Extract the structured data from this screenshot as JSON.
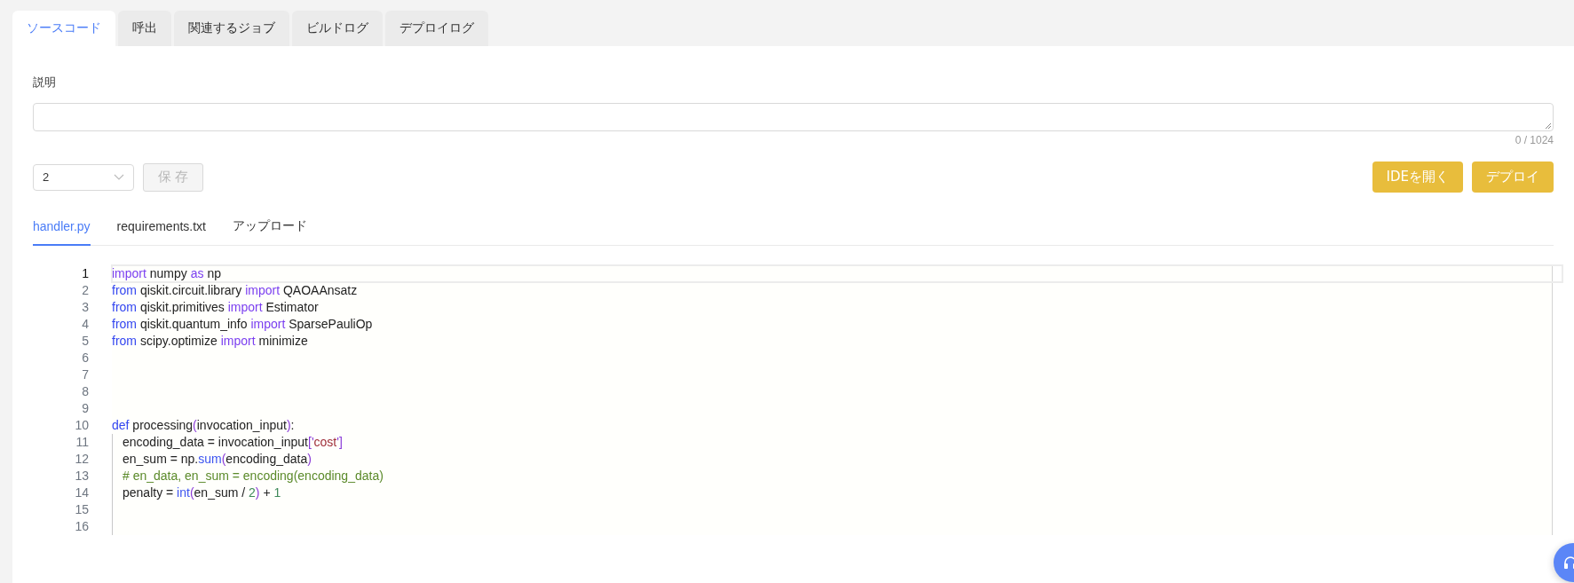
{
  "tabs": [
    {
      "label": "ソースコード",
      "selected": true
    },
    {
      "label": "呼出",
      "selected": false
    },
    {
      "label": "関連するジョブ",
      "selected": false
    },
    {
      "label": "ビルドログ",
      "selected": false
    },
    {
      "label": "デプロイログ",
      "selected": false
    }
  ],
  "description": {
    "label": "説明",
    "counter": "0 / 1024"
  },
  "version_select": {
    "value": "2"
  },
  "save_button": {
    "label": "保 存",
    "disabled": true
  },
  "actions": [
    {
      "label": "IDEを開く"
    },
    {
      "label": "デプロイ"
    }
  ],
  "file_tabs": [
    {
      "label": "handler.py",
      "selected": true
    },
    {
      "label": "requirements.txt",
      "selected": false
    },
    {
      "label": "アップロード",
      "selected": false
    }
  ],
  "editor": {
    "lines": [
      {
        "number": "1",
        "current": true,
        "indented": false,
        "tokens": [
          {
            "kind": "keyword",
            "text": "import"
          },
          {
            "kind": "plain",
            "text": " numpy "
          },
          {
            "kind": "keyword",
            "text": "as"
          },
          {
            "kind": "plain",
            "text": " np"
          }
        ]
      },
      {
        "number": "2",
        "current": false,
        "indented": false,
        "tokens": [
          {
            "kind": "control",
            "text": "from"
          },
          {
            "kind": "plain",
            "text": " qiskit.circuit.library "
          },
          {
            "kind": "keyword",
            "text": "import"
          },
          {
            "kind": "plain",
            "text": " QAOAAnsatz"
          }
        ]
      },
      {
        "number": "3",
        "current": false,
        "indented": false,
        "tokens": [
          {
            "kind": "control",
            "text": "from"
          },
          {
            "kind": "plain",
            "text": " qiskit.primitives "
          },
          {
            "kind": "keyword",
            "text": "import"
          },
          {
            "kind": "plain",
            "text": " Estimator"
          }
        ]
      },
      {
        "number": "4",
        "current": false,
        "indented": false,
        "tokens": [
          {
            "kind": "control",
            "text": "from"
          },
          {
            "kind": "plain",
            "text": " qiskit.quantum_info "
          },
          {
            "kind": "keyword",
            "text": "import"
          },
          {
            "kind": "plain",
            "text": " SparsePauliOp"
          }
        ]
      },
      {
        "number": "5",
        "current": false,
        "indented": false,
        "tokens": [
          {
            "kind": "control",
            "text": "from"
          },
          {
            "kind": "plain",
            "text": " scipy.optimize "
          },
          {
            "kind": "keyword",
            "text": "import"
          },
          {
            "kind": "plain",
            "text": " minimize"
          }
        ]
      },
      {
        "number": "6",
        "current": false,
        "indented": false
      },
      {
        "number": "7",
        "current": false,
        "indented": false
      },
      {
        "number": "8",
        "current": false,
        "indented": false
      },
      {
        "number": "9",
        "current": false,
        "indented": false
      },
      {
        "number": "10",
        "current": false,
        "indented": false,
        "tokens": [
          {
            "kind": "control",
            "text": "def"
          },
          {
            "kind": "plain",
            "text": " processing"
          },
          {
            "kind": "bracket",
            "text": "("
          },
          {
            "kind": "plain",
            "text": "invocation_input"
          },
          {
            "kind": "bracket",
            "text": ")"
          },
          {
            "kind": "plain",
            "text": ":"
          }
        ]
      },
      {
        "number": "11",
        "current": false,
        "indented": true,
        "tokens": [
          {
            "kind": "plain",
            "text": "encoding_data = invocation_input"
          },
          {
            "kind": "bracket",
            "text": "['"
          },
          {
            "kind": "string",
            "text": "cost"
          },
          {
            "kind": "bracket",
            "text": "']"
          }
        ]
      },
      {
        "number": "12",
        "current": false,
        "indented": true,
        "tokens": [
          {
            "kind": "plain",
            "text": "en_sum = np."
          },
          {
            "kind": "builtin",
            "text": "sum"
          },
          {
            "kind": "bracket",
            "text": "("
          },
          {
            "kind": "plain",
            "text": "encoding_data"
          },
          {
            "kind": "bracket",
            "text": ")"
          }
        ]
      },
      {
        "number": "13",
        "current": false,
        "indented": true,
        "tokens": [
          {
            "kind": "comment",
            "text": "# en_data, en_sum = encoding(encoding_data)"
          }
        ]
      },
      {
        "number": "14",
        "current": false,
        "indented": true,
        "tokens": [
          {
            "kind": "plain",
            "text": "penalty = "
          },
          {
            "kind": "builtin",
            "text": "int"
          },
          {
            "kind": "bracket",
            "text": "("
          },
          {
            "kind": "plain",
            "text": "en_sum / "
          },
          {
            "kind": "number",
            "text": "2"
          },
          {
            "kind": "bracket",
            "text": ")"
          },
          {
            "kind": "plain",
            "text": " + "
          },
          {
            "kind": "number",
            "text": "1"
          }
        ]
      },
      {
        "number": "15",
        "current": false,
        "indented": true
      },
      {
        "number": "16",
        "current": false,
        "indented": true
      }
    ]
  }
}
